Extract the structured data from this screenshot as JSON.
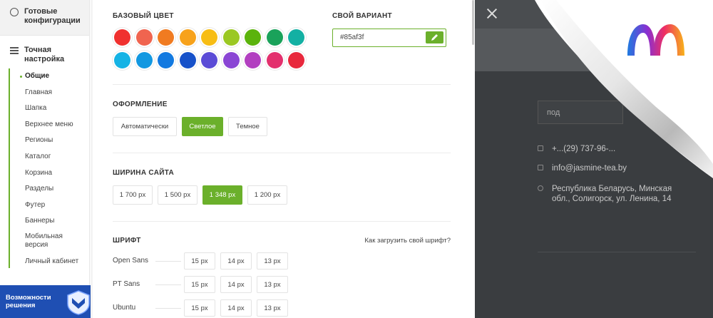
{
  "sidebar": {
    "ready_configs": "Готовые конфигурации",
    "fine_tuning": "Точная настройка",
    "items": [
      {
        "label": "Общие"
      },
      {
        "label": "Главная"
      },
      {
        "label": "Шапка"
      },
      {
        "label": "Верхнее меню"
      },
      {
        "label": "Регионы"
      },
      {
        "label": "Каталог"
      },
      {
        "label": "Корзина"
      },
      {
        "label": "Разделы"
      },
      {
        "label": "Футер"
      },
      {
        "label": "Баннеры"
      },
      {
        "label": "Мобильная версия"
      },
      {
        "label": "Личный кабинет"
      }
    ],
    "promo_text": "Возможности решения"
  },
  "base_color": {
    "title": "БАЗОВЫЙ ЦВЕТ",
    "swatches_row1": [
      "#f0312f",
      "#f0644f",
      "#f07b21",
      "#f7a21b",
      "#f7bd14",
      "#9bc823",
      "#5bb30c",
      "#1aa25a",
      "#13b0a3"
    ],
    "swatches_row2": [
      "#15b3e5",
      "#1298e1",
      "#1279e0",
      "#1651c9",
      "#5a4bd6",
      "#8a45d4",
      "#b23fc0",
      "#e3306d",
      "#e8283c"
    ]
  },
  "custom": {
    "title": "СВОЙ ВАРИАНТ",
    "value": "#85af3f"
  },
  "design": {
    "title": "ОФОРМЛЕНИЕ",
    "options": [
      "Автоматически",
      "Светлое",
      "Темное"
    ],
    "selected": "Светлое"
  },
  "width": {
    "title": "ШИРИНА САЙТА",
    "options": [
      "1 700 px",
      "1 500 px",
      "1 348 px",
      "1 200 px"
    ],
    "selected": "1 348 px"
  },
  "font": {
    "title": "ШРИФТ",
    "link": "Как загрузить свой шрифт?",
    "rows": [
      {
        "name": "Open Sans",
        "sizes": [
          "15 px",
          "14 px",
          "13 px"
        ]
      },
      {
        "name": "PT Sans",
        "sizes": [
          "15 px",
          "14 px",
          "13 px"
        ]
      },
      {
        "name": "Ubuntu",
        "sizes": [
          "15 px",
          "14 px",
          "13 px"
        ]
      }
    ]
  },
  "preview": {
    "input_placeholder": "под",
    "phone": "+...(29) 737-96-...",
    "email": "info@jasmine-tea.by",
    "address": "Республика Беларусь, Минская обл., Солигорск, ул. Ленина, 14"
  },
  "colors": {
    "accent": "#6bb02b",
    "promo": "#1f4fb3",
    "dark": "#3a3d40"
  }
}
